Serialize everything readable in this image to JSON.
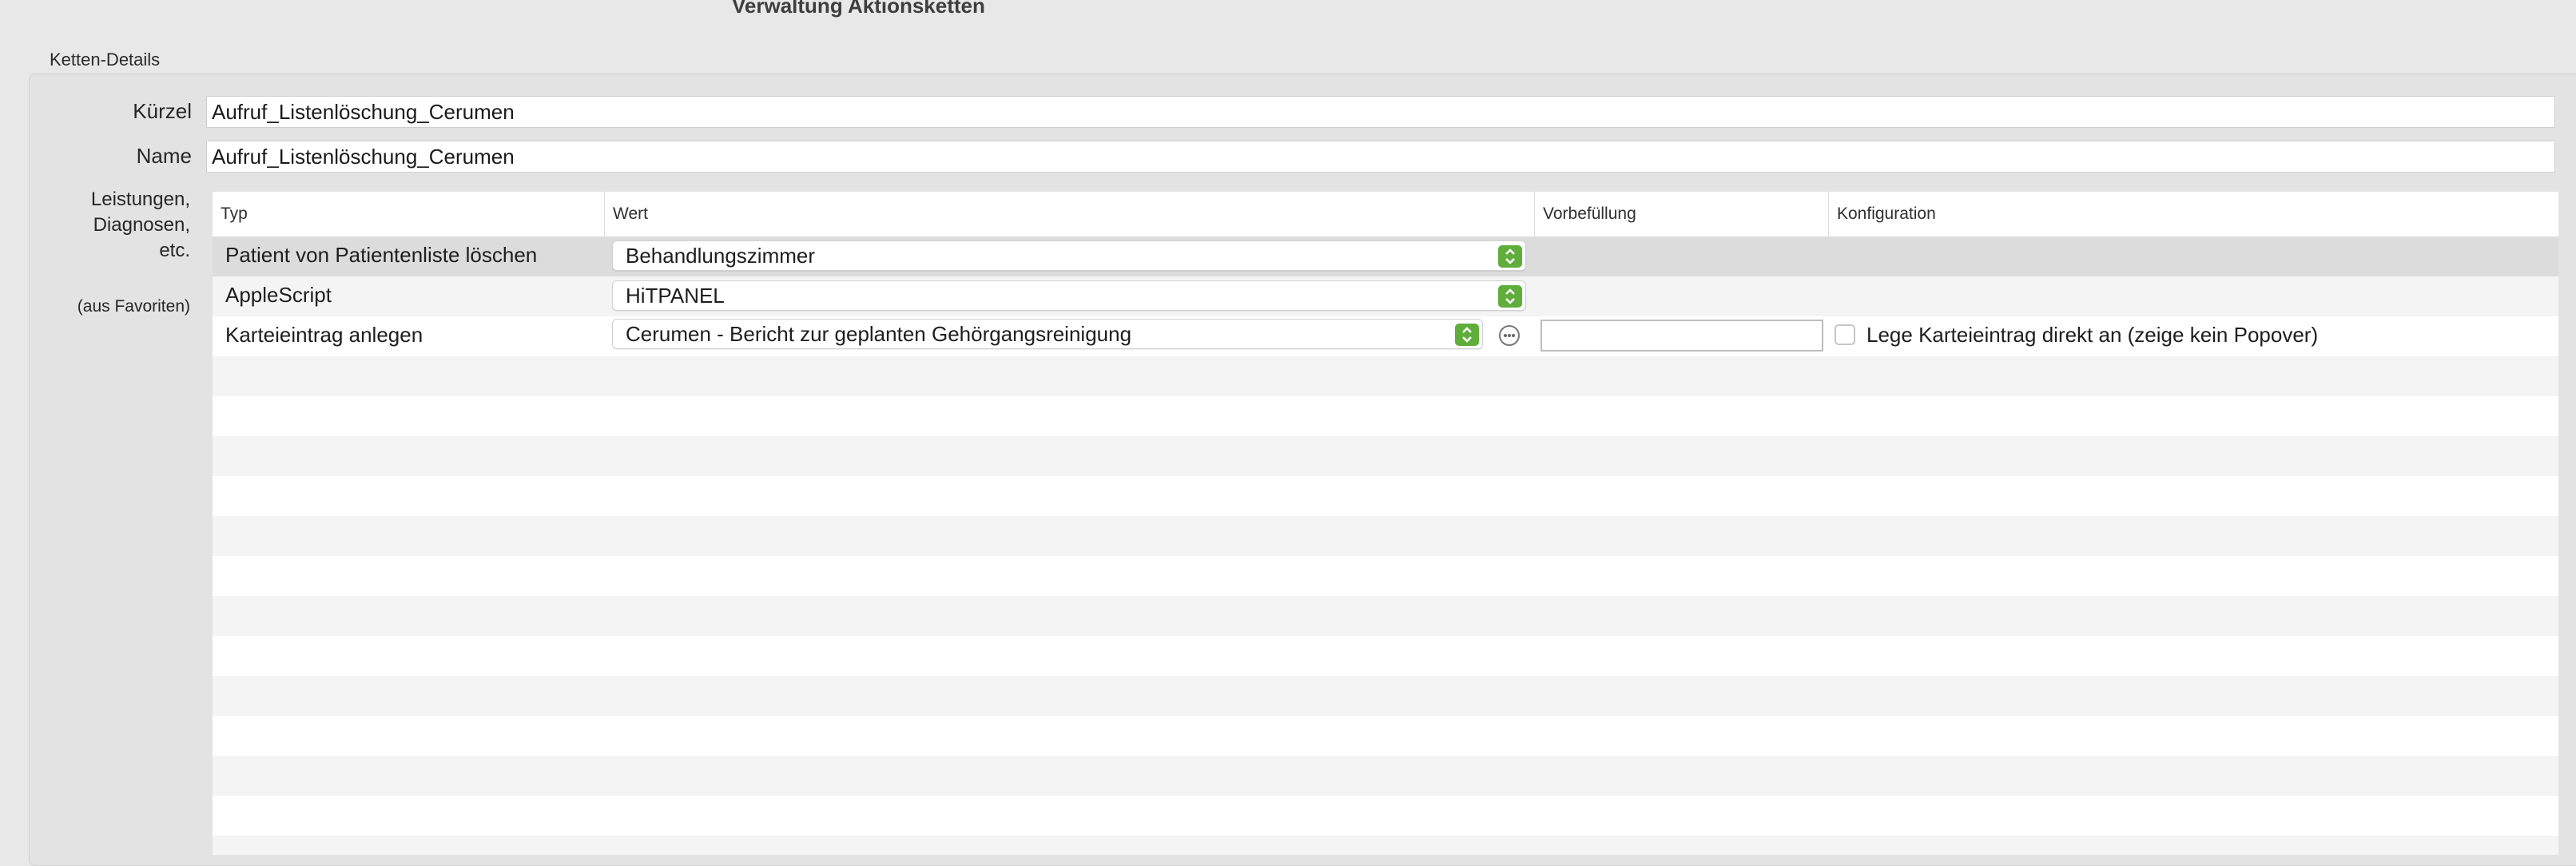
{
  "window": {
    "title": "Verwaltung Aktionsketten"
  },
  "group": {
    "title": "Ketten-Details"
  },
  "fields": {
    "kuerzel_label": "Kürzel",
    "kuerzel_value": "Aufruf_Listenlöschung_Cerumen",
    "name_label": "Name",
    "name_value": "Aufruf_Listenlöschung_Cerumen"
  },
  "side": {
    "label_line1": "Leistungen,",
    "label_line2": "Diagnosen,",
    "label_line3": "etc.",
    "note": "(aus Favoriten)"
  },
  "table": {
    "columns": [
      "Typ",
      "Wert",
      "Vorbefüllung",
      "Konfiguration"
    ],
    "rows": [
      {
        "typ": "Patient von Patientenliste löschen",
        "wert": "Behandlungszimmer",
        "selected": true
      },
      {
        "typ": "AppleScript",
        "wert": "HiTPANEL",
        "selected": false
      },
      {
        "typ": "Karteieintrag anlegen",
        "wert": "Cerumen - Bericht zur geplanten Gehörgangsreinigung",
        "vorbefuellung": "",
        "checkbox_checked": false,
        "konfiguration": "Lege Karteieintrag direkt an (zeige kein Popover)",
        "selected": false
      }
    ]
  },
  "colors": {
    "stepper_accent": "#5fae3b",
    "selected_row": "#dcdcdc",
    "alt_row": "#f3f4f3"
  },
  "icons": {
    "popup_indicator": "chevron-up-down-icon",
    "more": "ellipsis-circle-icon"
  }
}
